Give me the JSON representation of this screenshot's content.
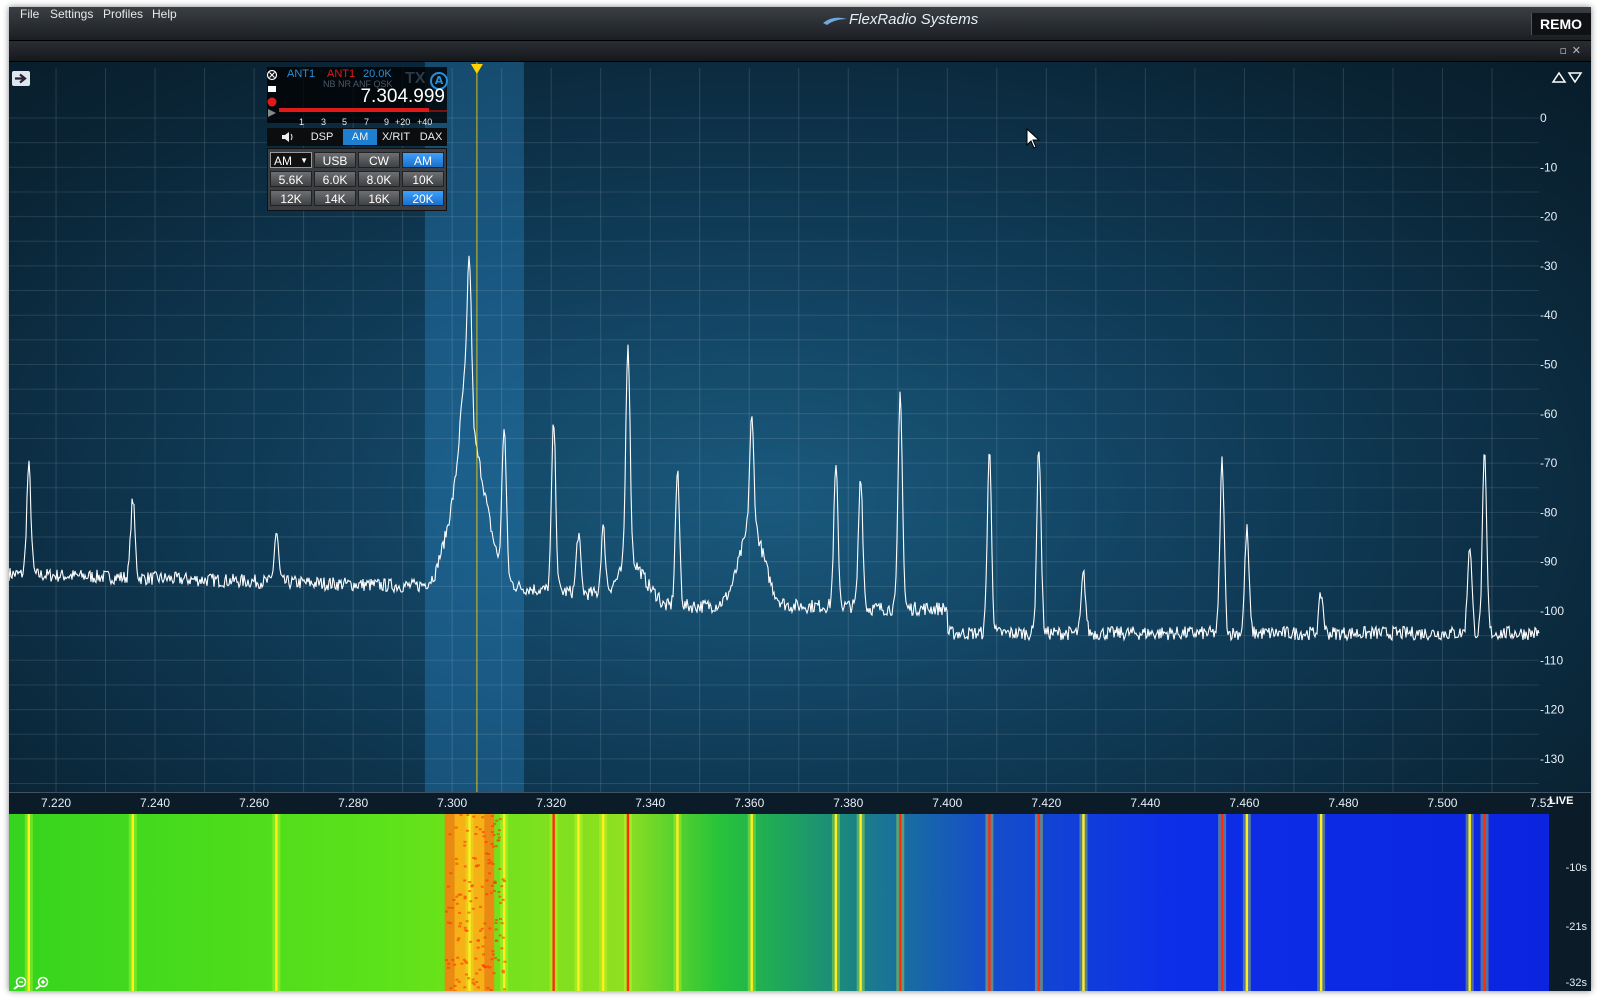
{
  "menu": {
    "file": "File",
    "settings": "Settings",
    "profiles": "Profiles",
    "help": "Help"
  },
  "brand": "FlexRadio Systems",
  "remote_label": "REMO",
  "panadapter": {
    "dbm_labels": [
      "0",
      "-10",
      "-20",
      "-30",
      "-40",
      "-50",
      "-60",
      "-70",
      "-80",
      "-90",
      "-100",
      "-110",
      "-120",
      "-130"
    ],
    "freq_labels": [
      "7.220",
      "7.240",
      "7.260",
      "7.280",
      "7.300",
      "7.320",
      "7.340",
      "7.360",
      "7.380",
      "7.400",
      "7.420",
      "7.440",
      "7.460",
      "7.480",
      "7.500",
      "7.52"
    ],
    "peak_freqs": [
      7.2145,
      7.2355,
      7.2645,
      7.3035,
      7.3105,
      7.3205,
      7.3255,
      7.3305,
      7.3355,
      7.3455,
      7.3605,
      7.3775,
      7.3825,
      7.3905,
      7.4085,
      7.4185,
      7.4275,
      7.4555,
      7.4605,
      7.4755,
      7.5055,
      7.5085
    ]
  },
  "slice": {
    "rx_ant": "ANT1",
    "tx_ant": "ANT1",
    "filter_width": "20.0K",
    "dsp_flags": "NB NR ANF QSK",
    "tx_label": "TX",
    "letter": "A",
    "frequency": "7.304.999",
    "smeter_scale": [
      "1",
      "3",
      "5",
      "7",
      "9",
      "+20",
      "+40"
    ],
    "signal_level": 0.9,
    "tabs": {
      "audio": "",
      "dsp": "DSP",
      "mode": "AM",
      "xrit": "X/RIT",
      "dax": "DAX"
    },
    "mode_select": "AM",
    "mode_buttons": [
      "USB",
      "CW",
      "AM"
    ],
    "filter_buttons": [
      "5.6K",
      "6.0K",
      "8.0K",
      "10K",
      "12K",
      "14K",
      "16K",
      "20K"
    ],
    "active_mode": "AM",
    "active_filter": "20K"
  },
  "waterfall": {
    "live_label": "LIVE",
    "time_labels": [
      "-10s",
      "-21s",
      "-32s"
    ]
  },
  "colors": {
    "accent": "#1e7fd0",
    "trace": "#ffffff",
    "filter_band": "#2a87c4",
    "tuning_line": "#ffd400"
  }
}
